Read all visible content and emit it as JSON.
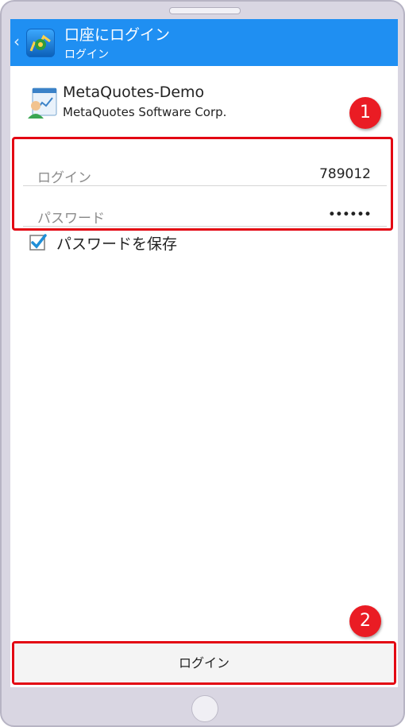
{
  "appbar": {
    "title": "口座にログイン",
    "subtitle": "ログイン",
    "back_icon": "chevron-left-icon",
    "app_icon": "metatrader-app-icon",
    "color": "#1f8ff2"
  },
  "server": {
    "name": "MetaQuotes-Demo",
    "company": "MetaQuotes Software Corp.",
    "icon": "server-user-icon"
  },
  "annotations": {
    "badge1": "1",
    "badge2": "2",
    "highlight_color": "#e30613"
  },
  "form": {
    "login_label": "ログイン",
    "login_value": "789012",
    "password_label": "パスワード",
    "password_value": "••••••",
    "save_password_label": "パスワードを保存",
    "save_password_checked": true,
    "checkbox_color": "#1f8fd8"
  },
  "footer": {
    "login_button_label": "ログイン"
  }
}
